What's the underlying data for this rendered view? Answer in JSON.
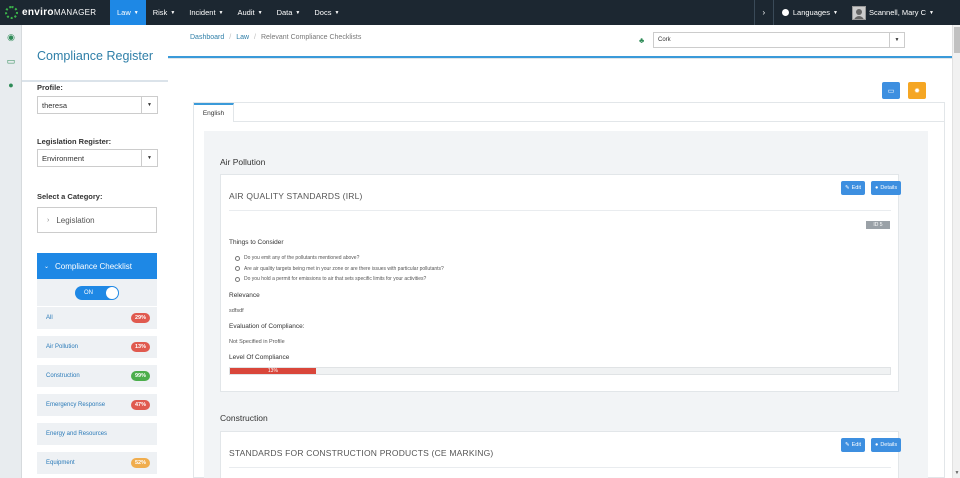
{
  "brand": {
    "name_bold": "enviro",
    "name_rest": "MANAGER"
  },
  "topnav": {
    "items": [
      {
        "label": "Law"
      },
      {
        "label": "Risk"
      },
      {
        "label": "Incident"
      },
      {
        "label": "Audit"
      },
      {
        "label": "Data"
      },
      {
        "label": "Docs"
      }
    ],
    "active": "Law",
    "chevron": "›",
    "languages_label": "Languages",
    "user_name": "Scannell, Mary C"
  },
  "rail": {
    "icons": [
      "dashboard-icon",
      "monitor-icon",
      "info-icon"
    ]
  },
  "sidebar": {
    "title": "Compliance Register",
    "profile_label": "Profile:",
    "profile_value": "theresa",
    "legislation_label": "Legislation Register:",
    "legislation_value": "Environment",
    "category_label": "Select a Category:",
    "category_legislation": "Legislation",
    "category_checklist": "Compliance Checklist",
    "toggle_label": "ON",
    "checklist_items": [
      {
        "label": "All",
        "pct": "29%",
        "color": "#e05a4f"
      },
      {
        "label": "Air Pollution",
        "pct": "13%",
        "color": "#e05a4f"
      },
      {
        "label": "Construction",
        "pct": "99%",
        "color": "#4cae4c"
      },
      {
        "label": "Emergency Response",
        "pct": "47%",
        "color": "#e05a4f"
      },
      {
        "label": "Energy and Resources",
        "pct": "",
        "color": ""
      },
      {
        "label": "Equipment",
        "pct": "52%",
        "color": "#f0ad4e"
      }
    ]
  },
  "breadcrumb": {
    "home": "Dashboard",
    "section": "Law",
    "current": "Relevant Compliance Checklists"
  },
  "site_select": {
    "value": "Cork"
  },
  "tab": {
    "label": "English"
  },
  "sections": [
    {
      "title": "Air Pollution",
      "card": {
        "title": "AIR QUALITY STANDARDS (IRL)",
        "edit_label": "Edit",
        "details_label": "Details",
        "id_tag": "ID 5",
        "consider_label": "Things to Consider",
        "bullets": [
          "Do you emit any of the pollutants mentioned above?",
          "Are air quality targets being met in your zone or are there issues with particular pollutants?",
          "Do you hold a permit for emissions to air that sets specific limits for your activities?"
        ],
        "relevance_label": "Relevance",
        "relevance_value": "sdfsdf",
        "evaluation_label": "Evaluation of Compliance:",
        "evaluation_value": "Not Specified in Profile",
        "level_label": "Level Of Compliance",
        "level_pct": 13,
        "level_text": "13%"
      }
    },
    {
      "title": "Construction",
      "card": {
        "title": "STANDARDS FOR CONSTRUCTION PRODUCTS (CE MARKING)",
        "edit_label": "Edit",
        "details_label": "Details"
      }
    }
  ],
  "colors": {
    "accent": "#1e88e5",
    "nav_bg": "#1c2731",
    "title": "#2f7fa8",
    "danger": "#d9463a",
    "orange": "#f5a623"
  }
}
